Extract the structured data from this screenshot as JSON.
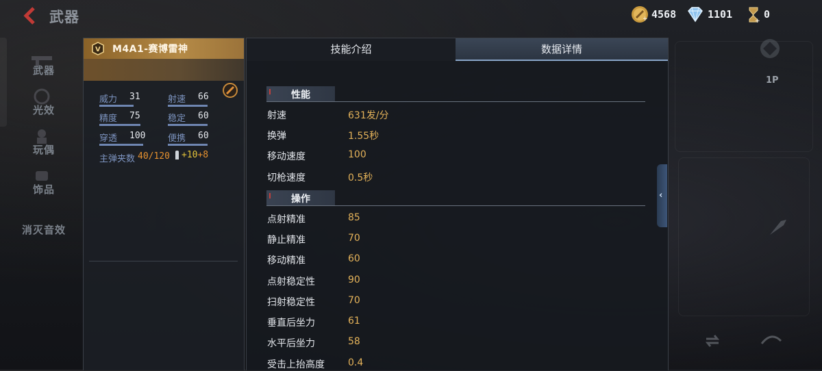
{
  "header": {
    "title": "武器",
    "currencies": [
      {
        "name": "gold-coin",
        "value": "4568"
      },
      {
        "name": "diamond",
        "value": "1101"
      },
      {
        "name": "ticket",
        "value": "0"
      }
    ]
  },
  "sidebar": {
    "items": [
      {
        "label": "武器"
      },
      {
        "label": "光效"
      },
      {
        "label": "玩偶"
      },
      {
        "label": "饰品"
      },
      {
        "label": "消灭音效"
      }
    ]
  },
  "weapon": {
    "name": "M4A1-赛博雷神",
    "stats": [
      {
        "label": "威力",
        "value": "31"
      },
      {
        "label": "射速",
        "value": "66"
      },
      {
        "label": "精度",
        "value": "75"
      },
      {
        "label": "稳定",
        "value": "60"
      },
      {
        "label": "穿透",
        "value": "100"
      },
      {
        "label": "便携",
        "value": "60"
      }
    ],
    "ammo_label": "主弹夹数",
    "ammo_value": "40/120",
    "ammo_bonus_1": "+10",
    "ammo_bonus_2": "+8"
  },
  "tabs": [
    {
      "label": "技能介绍",
      "active": false
    },
    {
      "label": "数据详情",
      "active": true
    }
  ],
  "details": {
    "sections": [
      {
        "title": "性能",
        "rows": [
          {
            "label": "射速",
            "value": "631发/分"
          },
          {
            "label": "换弹",
            "value": "1.55秒"
          },
          {
            "label": "移动速度",
            "value": "100"
          },
          {
            "label": "切枪速度",
            "value": "0.5秒"
          }
        ]
      },
      {
        "title": "操作",
        "rows": [
          {
            "label": "点射精准",
            "value": "85"
          },
          {
            "label": "静止精准",
            "value": "70"
          },
          {
            "label": "移动精准",
            "value": "60"
          },
          {
            "label": "点射稳定性",
            "value": "90"
          },
          {
            "label": "扫射稳定性",
            "value": "70"
          },
          {
            "label": "垂直后坐力",
            "value": "61"
          },
          {
            "label": "水平后坐力",
            "value": "58"
          },
          {
            "label": "受击上抬高度",
            "value": "0.4"
          }
        ]
      }
    ]
  },
  "right_controls": {
    "view_label": "1P"
  },
  "colors": {
    "accent_gold": "#e5b35a",
    "ammo_orange": "#e8922f",
    "stat_blue": "#7c93bf",
    "header_gold": "#b58a46"
  }
}
